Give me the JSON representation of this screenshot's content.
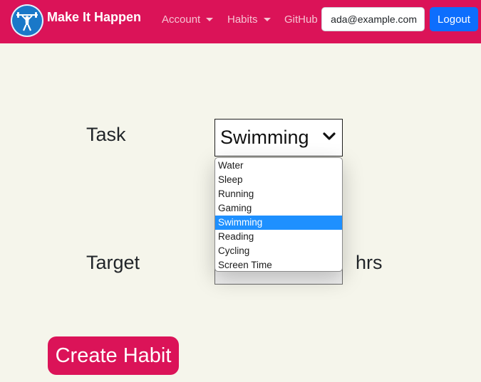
{
  "navbar": {
    "brand": "Make It Happen",
    "logo_icon": "weightlifter-icon",
    "links": {
      "account": "Account",
      "habits": "Habits",
      "github": "GitHub"
    },
    "email": "ada@example.com",
    "logout_label": "Logout"
  },
  "form": {
    "task_label": "Task",
    "task_selected": "Swimming",
    "task_options": [
      "Water",
      "Sleep",
      "Running",
      "Gaming",
      "Swimming",
      "Reading",
      "Cycling",
      "Screen Time"
    ],
    "target_label": "Target",
    "target_value": "",
    "target_unit": "hrs",
    "submit_label": "Create Habit"
  },
  "colors": {
    "navbar_bg": "#db1358",
    "page_bg": "#f5f5eb",
    "logout_bg": "#0d6efd",
    "option_highlight": "#1e90ff",
    "submit_bg": "#db1358"
  }
}
